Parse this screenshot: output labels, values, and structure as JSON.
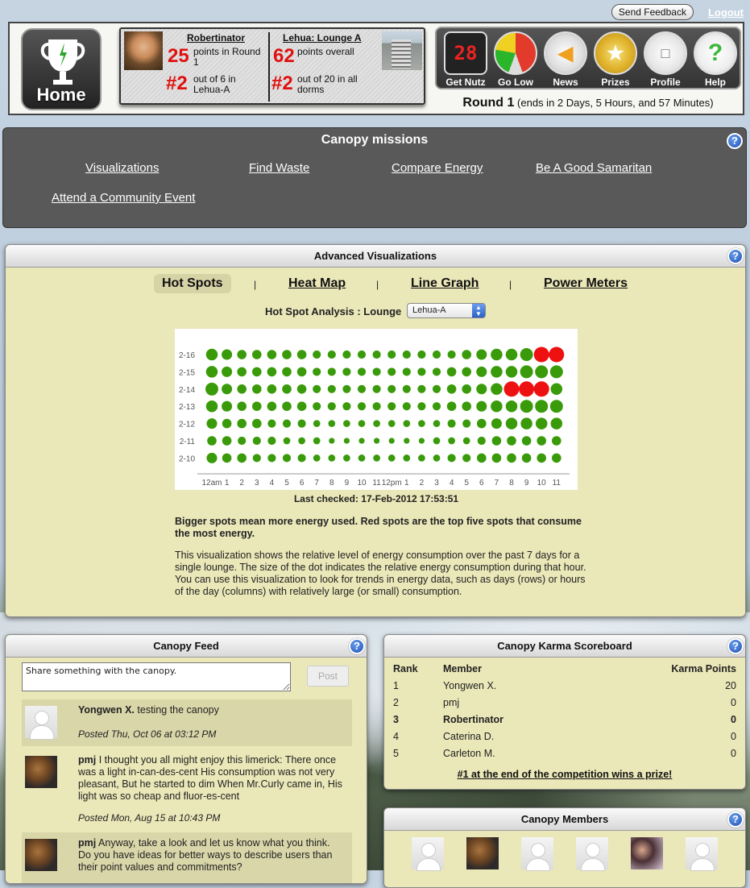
{
  "top": {
    "feedback_label": "Send Feedback",
    "logout_label": "Logout"
  },
  "header": {
    "home_label": "Home",
    "user": {
      "name": "Robertinator",
      "points": "25",
      "points_text": "points in Round 1",
      "rank": "#2",
      "rank_text": "out of 6 in Lehua-A"
    },
    "lounge": {
      "name": "Lehua: Lounge A",
      "points": "62",
      "points_text": "points overall",
      "rank": "#2",
      "rank_text": "out of 20 in all dorms"
    },
    "nav": [
      {
        "label": "Get Nutz",
        "icon": "scoreboard-icon",
        "glyph": "28"
      },
      {
        "label": "Go Low",
        "icon": "gauge-icon",
        "glyph": ""
      },
      {
        "label": "News",
        "icon": "megaphone-icon",
        "glyph": ""
      },
      {
        "label": "Prizes",
        "icon": "ribbon-icon",
        "glyph": ""
      },
      {
        "label": "Profile",
        "icon": "name-tag-icon",
        "glyph": ""
      },
      {
        "label": "Help",
        "icon": "question-icon",
        "glyph": "?"
      }
    ],
    "round_label": "Round 1",
    "round_ends": "(ends in 2 Days, 5 Hours, and 57 Minutes)"
  },
  "missions": {
    "title": "Canopy missions",
    "links": [
      "Visualizations",
      "Find Waste",
      "Compare Energy",
      "Be A Good Samaritan",
      "Attend a Community Event"
    ]
  },
  "viz": {
    "title": "Advanced Visualizations",
    "tabs": [
      "Hot Spots",
      "Heat Map",
      "Line Graph",
      "Power Meters"
    ],
    "separator": "|",
    "hotspot_label": "Hot Spot Analysis : Lounge",
    "lounge_selected": "Lehua-A",
    "last_checked": "Last checked: 17-Feb-2012 17:53:51",
    "bold_note": "Bigger spots mean more energy used. Red spots are the top five spots that consume the most energy.",
    "description": "This visualization shows the relative level of energy consumption over the past 7 days for a single lounge. The size of the dot indicates the relative energy consumption during that hour. You can use this visualization to look for trends in energy data, such as days (rows) or hours of the day (columns) with relatively large (or small) consumption."
  },
  "chart_data": {
    "type": "scatter",
    "x_tick_labels": [
      "12am",
      "1",
      "2",
      "3",
      "4",
      "5",
      "6",
      "7",
      "8",
      "9",
      "10",
      "11",
      "12pm",
      "1",
      "2",
      "3",
      "4",
      "5",
      "6",
      "7",
      "8",
      "9",
      "10",
      "11"
    ],
    "y_tick_labels": [
      "2-16",
      "2-15",
      "2-14",
      "2-13",
      "2-12",
      "2-11",
      "2-10"
    ],
    "values": [
      [
        5,
        4.5,
        4,
        4,
        4,
        4,
        4,
        3.5,
        3.5,
        3.5,
        3.5,
        3.5,
        3.5,
        3.5,
        3.5,
        3.5,
        3.5,
        4,
        4.5,
        5,
        5,
        5.5,
        6,
        6
      ],
      [
        5,
        4.5,
        4,
        4,
        4,
        4,
        4,
        3.5,
        3.5,
        3.5,
        3.5,
        3.5,
        3.5,
        3.5,
        3.5,
        3.5,
        4,
        4,
        4.5,
        5,
        5,
        5.5,
        5.5,
        5.5
      ],
      [
        5.5,
        4.5,
        4,
        4,
        4,
        4,
        4,
        3.5,
        3.5,
        3.5,
        3.5,
        3.5,
        3.5,
        3.5,
        3.5,
        3.5,
        4,
        4,
        4.5,
        5,
        6,
        6,
        6,
        5
      ],
      [
        5,
        4.5,
        4,
        4,
        4,
        4,
        4,
        3.5,
        3.5,
        3.5,
        3.5,
        3.5,
        3.5,
        3.5,
        3.5,
        3.5,
        4,
        4,
        4.5,
        5,
        5,
        5.5,
        5.5,
        5.5
      ],
      [
        4.5,
        4,
        4,
        4,
        3.5,
        3.5,
        3.5,
        3,
        3,
        3,
        3,
        3,
        3,
        3,
        3,
        3,
        3.5,
        3.5,
        4,
        4.5,
        5,
        5,
        5,
        5
      ],
      [
        4,
        4,
        3.5,
        3.5,
        3.5,
        3,
        3,
        3,
        2.5,
        2.5,
        2.5,
        2.5,
        2.5,
        2.5,
        2.5,
        3,
        3,
        3,
        3.5,
        4,
        4,
        4,
        4,
        4
      ],
      [
        4.5,
        4,
        4,
        3.5,
        3.5,
        3.5,
        3.5,
        3,
        3,
        3,
        3,
        3,
        3,
        3,
        3,
        3,
        3.5,
        3.5,
        4,
        4,
        4,
        4,
        4,
        4
      ]
    ],
    "red_cells": [
      [
        0,
        22
      ],
      [
        0,
        23
      ],
      [
        2,
        20
      ],
      [
        2,
        21
      ],
      [
        2,
        22
      ]
    ],
    "colors": {
      "normal": "#3a9b0a",
      "top": "#ee1111"
    },
    "grid": false
  },
  "feed": {
    "title": "Canopy Feed",
    "placeholder": "Share something with the canopy.",
    "post_label": "Post",
    "items": [
      {
        "author": "Yongwen X.",
        "text": "testing the canopy",
        "time": "Posted Thu, Oct 06 at 03:12 PM"
      },
      {
        "author": "pmj",
        "text": "I thought you all might enjoy this limerick: There once was a light in-can-des-cent His consumption was not very pleasant, But he started to dim When Mr.Curly came in, His light was so cheap and fluor-es-cent",
        "time": "Posted Mon, Aug 15 at 10:43 PM"
      },
      {
        "author": "pmj",
        "text": "Anyway, take a look and let us know what you think. Do you have ideas for better ways to describe users than their point values and commitments?"
      }
    ]
  },
  "karma": {
    "title": "Canopy Karma Scoreboard",
    "headers": [
      "Rank",
      "Member",
      "Karma Points"
    ],
    "rows": [
      [
        "1",
        "Yongwen X.",
        "20"
      ],
      [
        "2",
        "pmj",
        "0"
      ],
      [
        "3",
        "Robertinator",
        "0"
      ],
      [
        "4",
        "Caterina D.",
        "0"
      ],
      [
        "5",
        "Carleton M.",
        "0"
      ]
    ],
    "prize_link": "#1 at the end of the competition wins a prize!"
  },
  "members": {
    "title": "Canopy Members"
  },
  "help_glyph": "?"
}
